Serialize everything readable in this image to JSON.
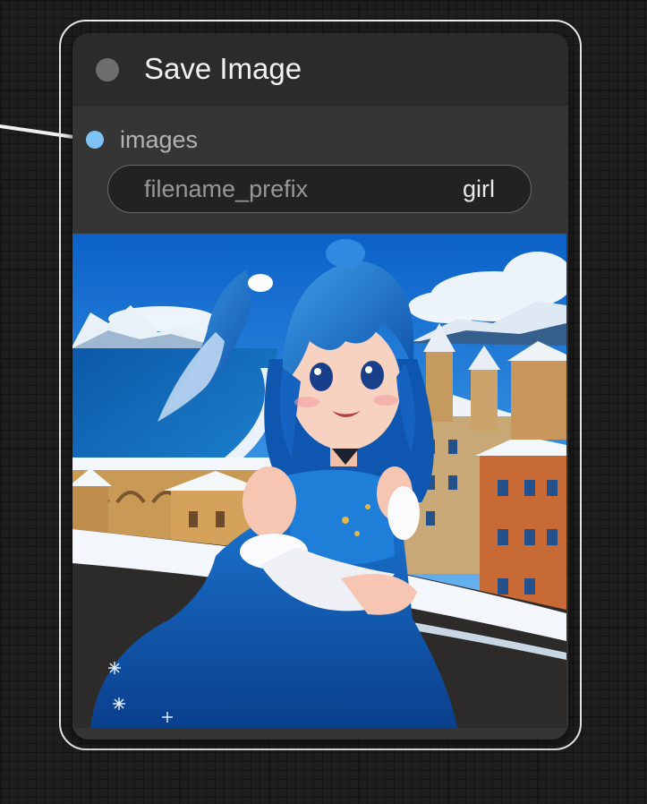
{
  "node": {
    "title": "Save Image",
    "inputs": [
      {
        "label": "images",
        "color": "#7ec2f4"
      }
    ],
    "widgets": [
      {
        "name": "filename_prefix",
        "value": "girl"
      }
    ],
    "preview": {
      "icon": "generated-image-preview"
    }
  },
  "colors": {
    "canvas_background": "#1e1e1e",
    "node_body": "#353535",
    "node_header": "#2b2b2b",
    "selection_outline": "#e6e6e6",
    "image_slot": "#7ec2f4",
    "link_wire": "#f0f0f0"
  }
}
